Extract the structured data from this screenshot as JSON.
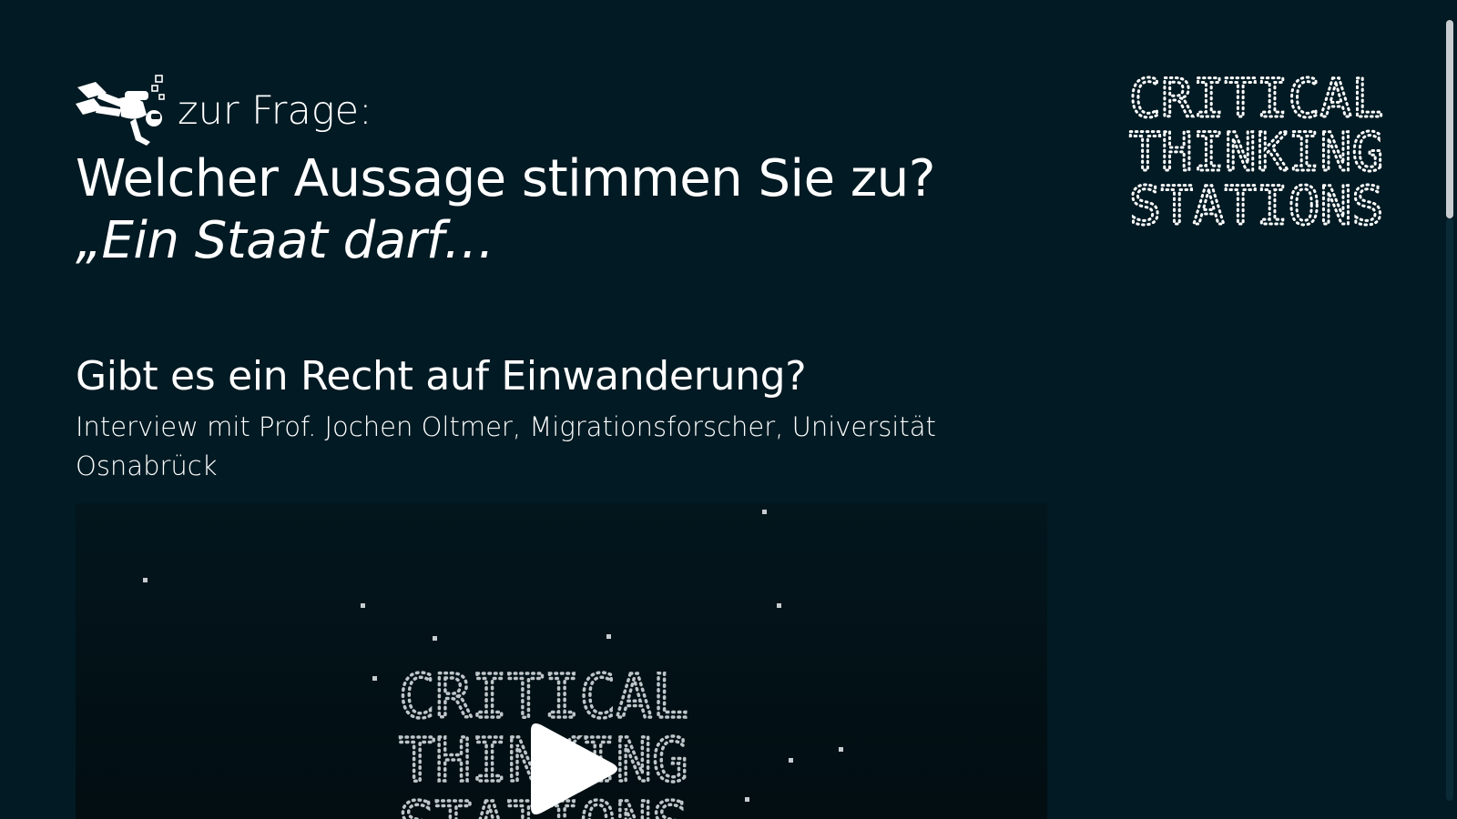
{
  "header": {
    "kicker": "zur Frage:",
    "question": "Welcher Aussage stimmen Sie zu?",
    "quote": "„Ein Staat darf…"
  },
  "section": {
    "title": "Gibt es ein Recht auf Einwanderung?",
    "subtitle": "Interview mit Prof. Jochen Oltmer, Migrationsforscher, Universität Osnabrück"
  },
  "logo": {
    "line1": "CRITICAL",
    "line2": "THINKING",
    "line3": "STATIONS"
  },
  "video": {
    "poster_line1": "CRITICAL",
    "poster_line2": "THINKING",
    "poster_line3": "STATIONS",
    "play_icon": "play-icon"
  },
  "icons": {
    "kicker_icon": "diver-icon"
  },
  "colors": {
    "background": "#021a23",
    "text": "#ffffff",
    "video_background": "#020d11",
    "scrollbar_thumb": "#c8cdd0"
  }
}
